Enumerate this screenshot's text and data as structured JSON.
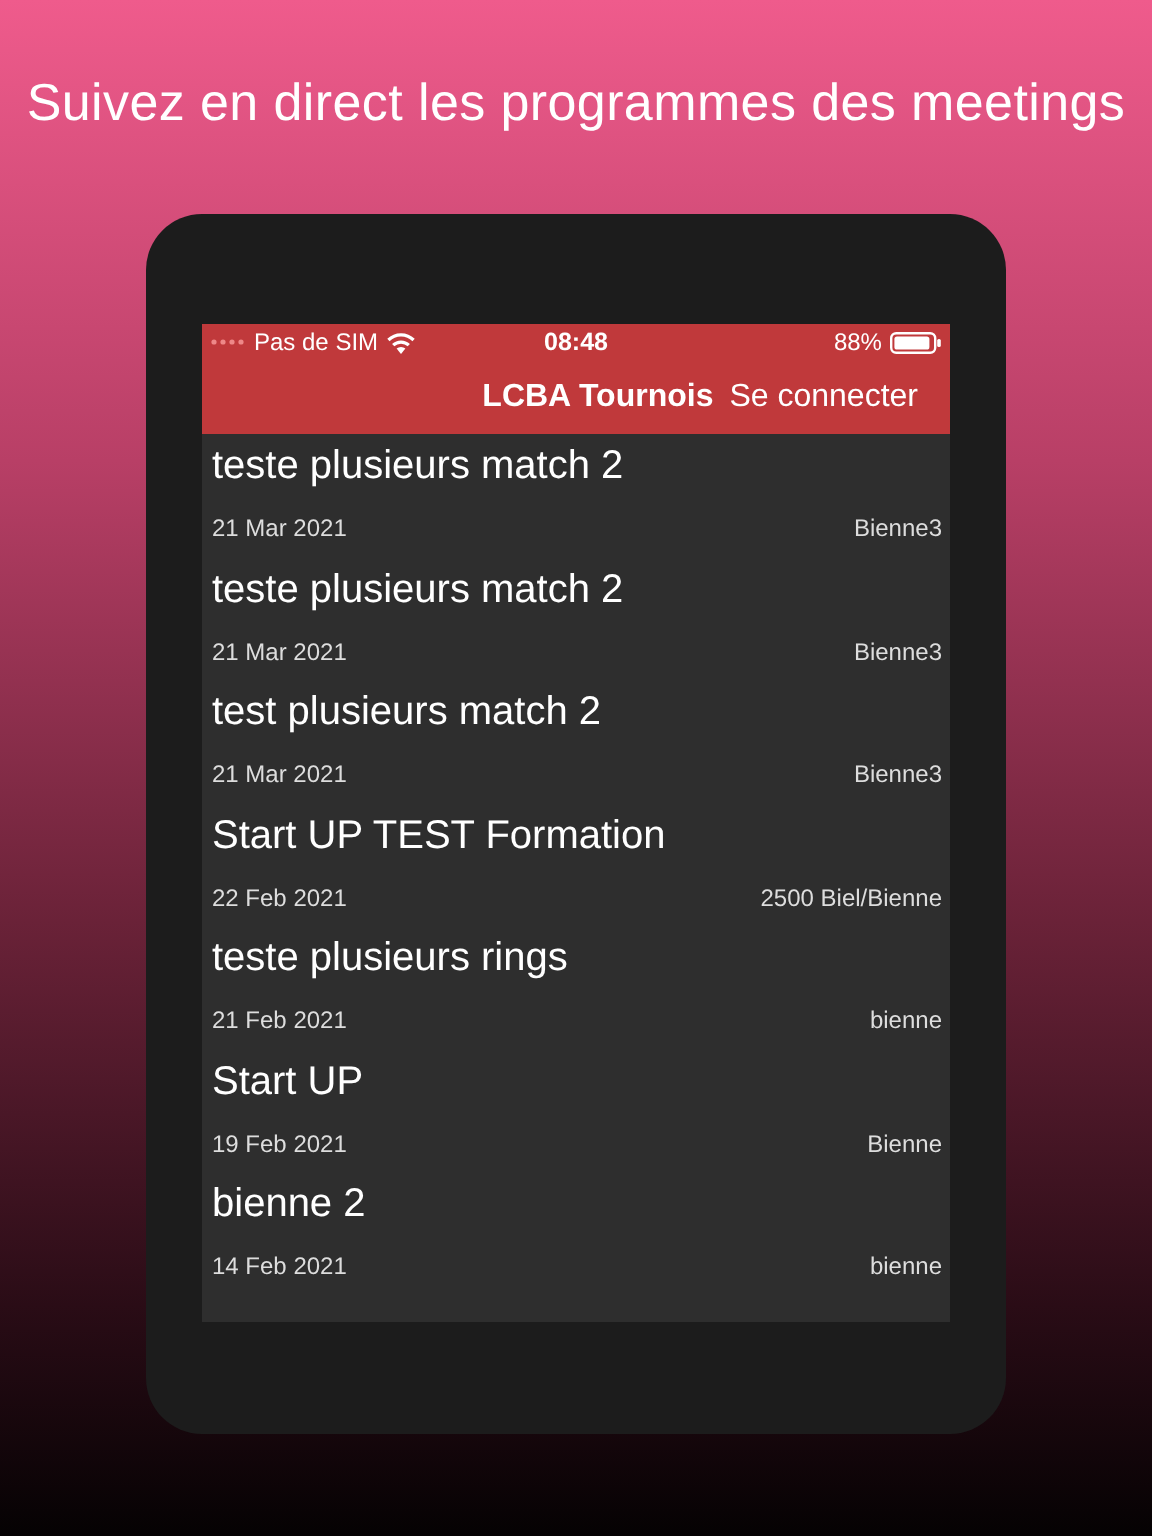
{
  "headline": "Suivez en direct les programmes des meetings",
  "status_bar": {
    "carrier": "Pas de SIM",
    "time": "08:48",
    "battery": "88%"
  },
  "nav_bar": {
    "title": "LCBA Tournois",
    "action": "Se connecter"
  },
  "events": [
    {
      "title": "teste plusieurs match 2",
      "date": "21 Mar 2021",
      "place": "Bienne3"
    },
    {
      "title": "teste plusieurs match 2",
      "date": "21 Mar 2021",
      "place": "Bienne3"
    },
    {
      "title": "test plusieurs match 2",
      "date": "21 Mar 2021",
      "place": "Bienne3"
    },
    {
      "title": "Start UP TEST Formation",
      "date": "22 Feb 2021",
      "place": "2500 Biel/Bienne"
    },
    {
      "title": "teste plusieurs rings",
      "date": "21 Feb 2021",
      "place": "bienne"
    },
    {
      "title": "Start UP",
      "date": "19 Feb 2021",
      "place": "Bienne"
    },
    {
      "title": "bienne 2",
      "date": "14 Feb 2021",
      "place": "bienne"
    }
  ]
}
